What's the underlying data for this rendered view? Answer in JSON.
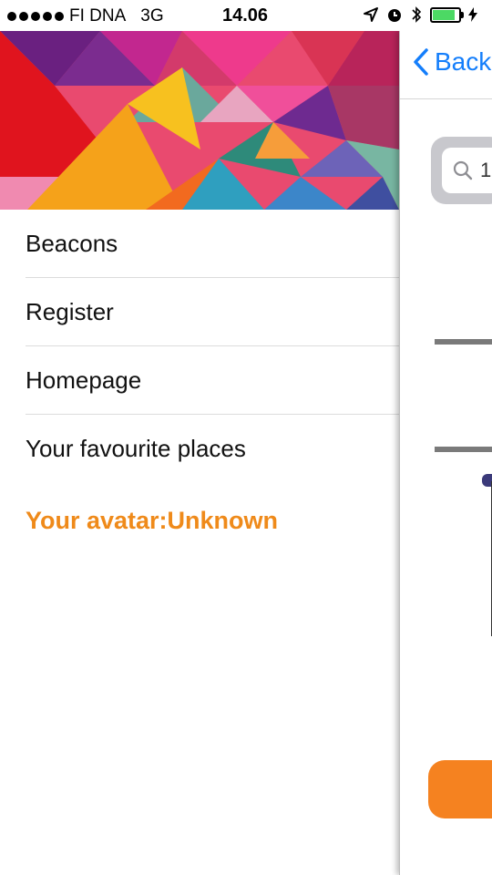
{
  "status_bar": {
    "carrier": "FI DNA",
    "network": "3G",
    "time": "14.06"
  },
  "drawer": {
    "menu_items": [
      {
        "label": "Beacons"
      },
      {
        "label": "Register"
      },
      {
        "label": "Homepage"
      },
      {
        "label": "Your favourite places"
      }
    ],
    "avatar_text": "Your avatar:Unknown"
  },
  "main_view": {
    "back_label": "Back",
    "search_value": "1"
  },
  "colors": {
    "accent_orange": "#f58220",
    "ios_blue": "#147efb",
    "battery_green": "#4cd964"
  }
}
